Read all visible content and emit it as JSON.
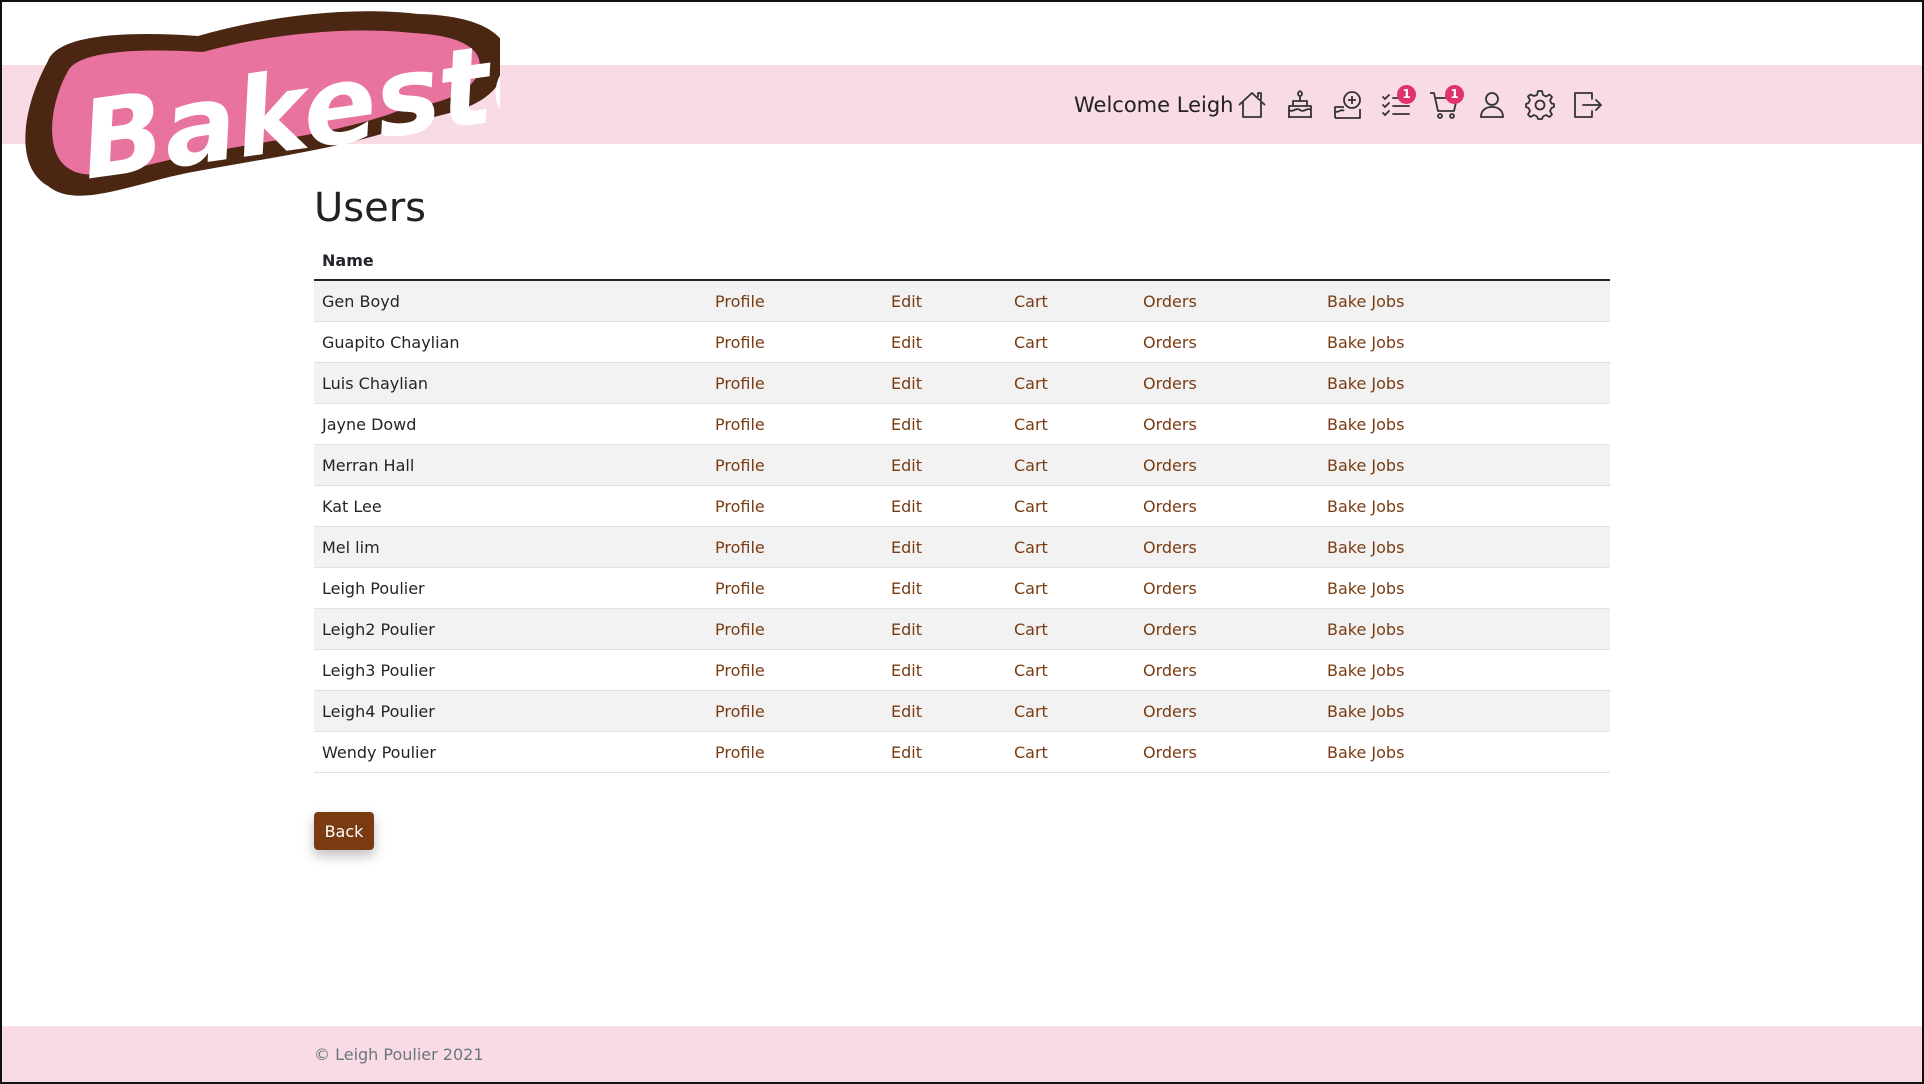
{
  "brand": {
    "name": "Bakester",
    "color": "#e8739f",
    "outline": "#4a2613"
  },
  "header": {
    "welcome": "Welcome Leigh",
    "icons": [
      {
        "name": "home-icon",
        "badge": ""
      },
      {
        "name": "cake-icon",
        "badge": ""
      },
      {
        "name": "add-cake-icon",
        "badge": ""
      },
      {
        "name": "task-list-icon",
        "badge": "1"
      },
      {
        "name": "cart-icon",
        "badge": "1"
      },
      {
        "name": "user-icon",
        "badge": ""
      },
      {
        "name": "gear-icon",
        "badge": ""
      },
      {
        "name": "logout-icon",
        "badge": ""
      }
    ]
  },
  "page": {
    "title": "Users"
  },
  "table": {
    "headers": [
      "Name",
      "",
      "",
      "",
      "",
      ""
    ],
    "link_labels": {
      "profile": "Profile",
      "edit": "Edit",
      "cart": "Cart",
      "orders": "Orders",
      "bake_jobs": "Bake Jobs"
    },
    "rows": [
      "Gen Boyd",
      "Guapito Chaylian",
      "Luis Chaylian",
      "Jayne Dowd",
      "Merran Hall",
      "Kat Lee",
      "Mel lim",
      "Leigh Poulier",
      "Leigh2 Poulier",
      "Leigh3 Poulier",
      "Leigh4 Poulier",
      "Wendy Poulier"
    ]
  },
  "actions": {
    "back_label": "Back"
  },
  "footer": {
    "copyright": "© Leigh Poulier 2021"
  },
  "colors": {
    "accent": "#7a3b12",
    "pink_bar": "#f8dbe4",
    "badge": "#e0336e"
  }
}
